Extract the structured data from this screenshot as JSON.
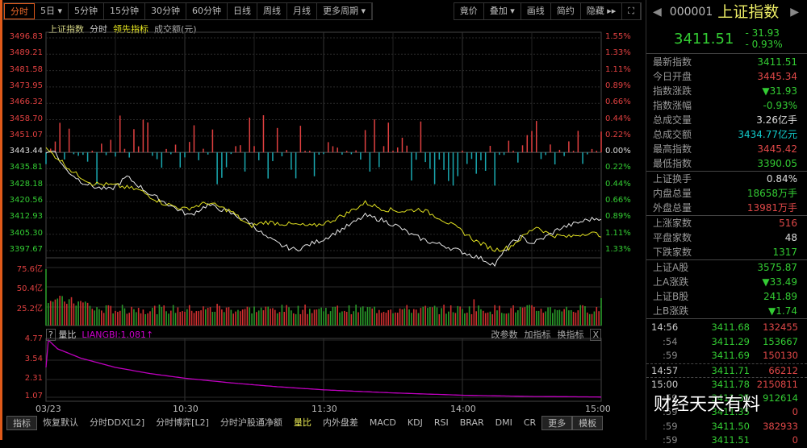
{
  "toolbar": {
    "periods": [
      "分时",
      "5日 ▾",
      "5分钟",
      "15分钟",
      "30分钟",
      "60分钟",
      "日线",
      "周线",
      "月线",
      "更多周期 ▾"
    ],
    "right": [
      "竟价",
      "叠加 ▾",
      "画线",
      "简约",
      "隐藏 ▸▸",
      "⛶"
    ]
  },
  "legend": {
    "name": "上证指数",
    "time": "分时",
    "lead": "领先指标",
    "amount": "成交额(元)"
  },
  "price_axis": {
    "left": [
      "3496.83",
      "3489.21",
      "3481.58",
      "3473.95",
      "3466.32",
      "3458.70",
      "3451.07",
      "3443.44",
      "3435.81",
      "3428.18",
      "3420.56",
      "3412.93",
      "3405.30",
      "3397.67"
    ],
    "right": [
      "1.55%",
      "1.33%",
      "1.11%",
      "0.89%",
      "0.66%",
      "0.44%",
      "0.22%",
      "0.00%",
      "0.22%",
      "0.44%",
      "0.66%",
      "0.89%",
      "1.11%",
      "1.33%"
    ]
  },
  "volume_axis": [
    "75.6亿",
    "50.4亿",
    "25.2亿"
  ],
  "indicator": {
    "help": "?",
    "name": "量比",
    "value": "LIANGBI:1.081↑",
    "actions": [
      "改参数",
      "加指标",
      "换指标",
      "X"
    ],
    "axis": [
      "4.77",
      "3.54",
      "2.31",
      "1.07"
    ]
  },
  "time_axis": [
    "03/23",
    "10:30",
    "11:30",
    "14:00",
    "15:00"
  ],
  "bottom_tabs": [
    "指标",
    "恢复默认",
    "分时DDX[L2]",
    "分时博弈[L2]",
    "分时沪股通净额",
    "量比",
    "内外盘差",
    "MACD",
    "KDJ",
    "RSI",
    "BRAR",
    "DMI",
    "CR",
    "更多",
    "模板"
  ],
  "chart_data": {
    "type": "line",
    "x_range": [
      0,
      240
    ],
    "ylim": [
      3397.67,
      3496.83
    ],
    "series": [
      {
        "name": "上证指数",
        "color": "#e8e8e8",
        "points": [
          [
            0,
            3443
          ],
          [
            3,
            3445
          ],
          [
            8,
            3436
          ],
          [
            15,
            3430
          ],
          [
            22,
            3427
          ],
          [
            28,
            3426
          ],
          [
            35,
            3432
          ],
          [
            40,
            3428
          ],
          [
            45,
            3424
          ],
          [
            55,
            3418
          ],
          [
            62,
            3414
          ],
          [
            70,
            3419
          ],
          [
            78,
            3416
          ],
          [
            88,
            3411
          ],
          [
            95,
            3404
          ],
          [
            102,
            3400
          ],
          [
            108,
            3398
          ],
          [
            115,
            3401
          ],
          [
            120,
            3403
          ],
          [
            125,
            3406
          ],
          [
            132,
            3410
          ],
          [
            138,
            3414
          ],
          [
            145,
            3412
          ],
          [
            152,
            3409
          ],
          [
            158,
            3405
          ],
          [
            165,
            3402
          ],
          [
            172,
            3400
          ],
          [
            180,
            3397
          ],
          [
            188,
            3394
          ],
          [
            194,
            3391
          ],
          [
            200,
            3400
          ],
          [
            205,
            3404
          ],
          [
            210,
            3401
          ],
          [
            216,
            3404
          ],
          [
            222,
            3408
          ],
          [
            228,
            3410
          ],
          [
            234,
            3412
          ],
          [
            240,
            3413
          ]
        ]
      },
      {
        "name": "领先指标",
        "color": "#e0e020",
        "points": [
          [
            0,
            3445
          ],
          [
            6,
            3440
          ],
          [
            12,
            3434
          ],
          [
            20,
            3429
          ],
          [
            30,
            3428
          ],
          [
            40,
            3426
          ],
          [
            50,
            3420
          ],
          [
            60,
            3417
          ],
          [
            70,
            3420
          ],
          [
            80,
            3416
          ],
          [
            88,
            3409
          ],
          [
            95,
            3411
          ],
          [
            105,
            3410
          ],
          [
            115,
            3409
          ],
          [
            122,
            3411
          ],
          [
            130,
            3415
          ],
          [
            138,
            3420
          ],
          [
            146,
            3417
          ],
          [
            154,
            3416
          ],
          [
            162,
            3417
          ],
          [
            170,
            3413
          ],
          [
            178,
            3408
          ],
          [
            186,
            3402
          ],
          [
            194,
            3398
          ],
          [
            200,
            3399
          ],
          [
            206,
            3404
          ],
          [
            212,
            3409
          ],
          [
            218,
            3405
          ],
          [
            226,
            3404
          ],
          [
            234,
            3406
          ],
          [
            240,
            3405
          ]
        ]
      },
      {
        "name": "量比",
        "color": "#c000c0",
        "ylim": [
          0.9,
          4.9
        ],
        "points": [
          [
            0,
            3.0
          ],
          [
            1,
            4.77
          ],
          [
            5,
            4.2
          ],
          [
            15,
            3.6
          ],
          [
            30,
            3.0
          ],
          [
            45,
            2.6
          ],
          [
            60,
            2.3
          ],
          [
            80,
            2.0
          ],
          [
            100,
            1.75
          ],
          [
            120,
            1.55
          ],
          [
            150,
            1.35
          ],
          [
            180,
            1.2
          ],
          [
            210,
            1.12
          ],
          [
            238,
            1.09
          ],
          [
            240,
            1.081
          ]
        ]
      }
    ]
  },
  "quote": {
    "code": "000001",
    "name": "上证指数",
    "price": "3411.51",
    "change": "- 31.93",
    "pct": "- 0.93%",
    "rows1": [
      [
        "最新指数",
        "3411.51",
        "g"
      ],
      [
        "今日开盘",
        "3445.34",
        "r"
      ],
      [
        "指数涨跌",
        "▼31.93",
        "g"
      ],
      [
        "指数涨幅",
        "-0.93%",
        "g"
      ],
      [
        "总成交量",
        "3.26亿手",
        "w"
      ],
      [
        "总成交额",
        "3434.77亿元",
        "c"
      ],
      [
        "最高指数",
        "3445.42",
        "r"
      ],
      [
        "最低指数",
        "3390.05",
        "g"
      ]
    ],
    "rows2": [
      [
        "上证换手",
        "0.84%",
        "w"
      ],
      [
        "内盘总量",
        "18658万手",
        "g"
      ],
      [
        "外盘总量",
        "13981万手",
        "r"
      ]
    ],
    "rows3": [
      [
        "上涨家数",
        "516",
        "r"
      ],
      [
        "平盘家数",
        "48",
        "w"
      ],
      [
        "下跌家数",
        "1317",
        "g"
      ]
    ],
    "rows4": [
      [
        "上证A股",
        "3575.87",
        "g"
      ],
      [
        "上A涨跌",
        "▼33.49",
        "g"
      ],
      [
        "上证B股",
        "241.89",
        "g"
      ],
      [
        "上B涨跌",
        "▼1.74",
        "g"
      ]
    ],
    "ticks": [
      [
        "14:56",
        "3411.68",
        "132455",
        "r"
      ],
      [
        ":54",
        "3411.29",
        "153667",
        "g"
      ],
      [
        ":59",
        "3411.69",
        "150130",
        "r"
      ],
      [
        "14:57",
        "3411.71",
        "66212",
        "r"
      ],
      [
        "15:00",
        "3411.78",
        "2150811",
        "r"
      ],
      [
        ":59",
        "3411.35",
        "912614",
        "g"
      ],
      [
        ":59",
        "3411.35",
        "0",
        "r"
      ],
      [
        ":59",
        "3411.50",
        "382933",
        "r"
      ],
      [
        ":59",
        "3411.51",
        "0",
        "r"
      ]
    ]
  },
  "watermark": "财经天天有料"
}
